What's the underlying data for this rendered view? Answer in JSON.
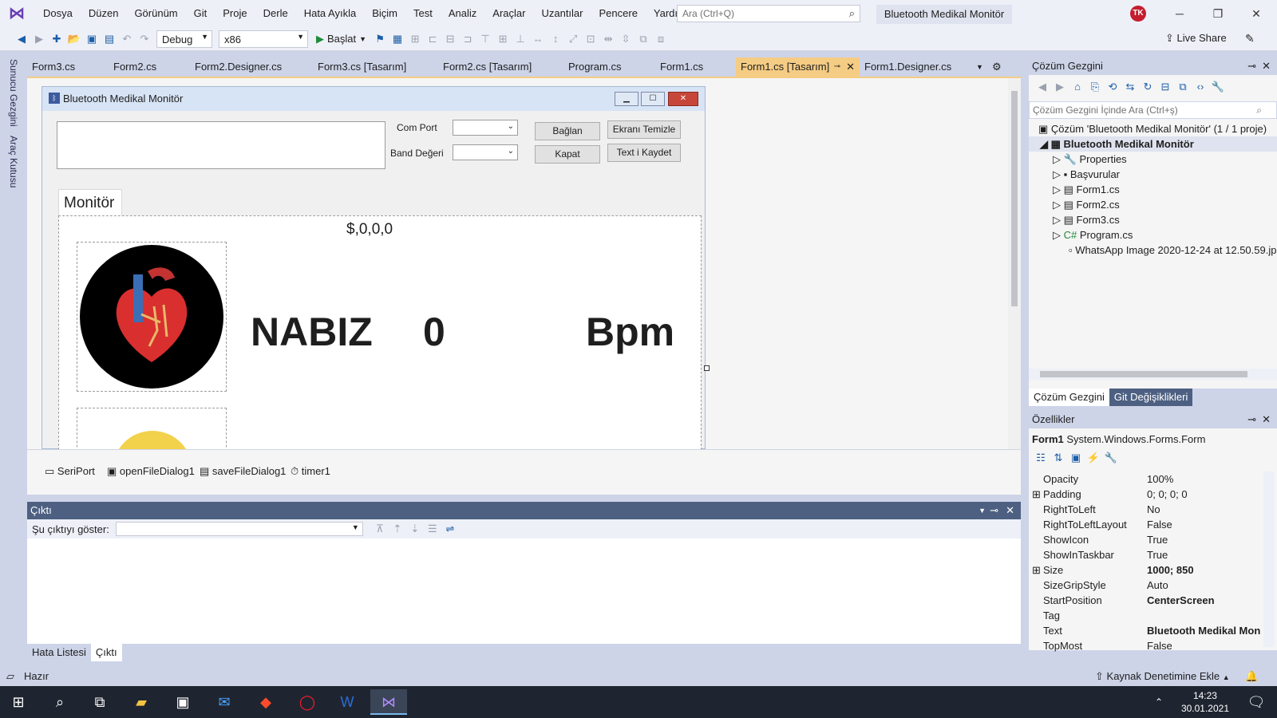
{
  "menubar": {
    "items": [
      "Dosya",
      "Düzen",
      "Görünüm",
      "Git",
      "Proje",
      "Derle",
      "Hata Ayıkla",
      "Biçim",
      "Test",
      "Analiz",
      "Araçlar",
      "Uzantılar",
      "Pencere",
      "Yardım"
    ],
    "search_placeholder": "Ara (Ctrl+Q)",
    "solution_title": "Bluetooth Medikal Monitör",
    "avatar": "TK"
  },
  "toolbar": {
    "config": "Debug",
    "platform": "x86",
    "start": "Başlat",
    "live_share": "Live Share"
  },
  "side_tabs": [
    "Sunucu Gezgini",
    "Araç Kutusu"
  ],
  "doc_tabs": [
    "Form3.cs",
    "Form2.cs",
    "Form2.Designer.cs",
    "Form3.cs [Tasarım]",
    "Form2.cs [Tasarım]",
    "Program.cs",
    "Form1.cs",
    "Form1.cs [Tasarım]",
    "Form1.Designer.cs"
  ],
  "active_tab_index": 7,
  "form": {
    "title": "Bluetooth Medikal Monitör",
    "com_port_label": "Com Port",
    "band_label": "Band Değeri",
    "connect": "Bağlan",
    "clear": "Ekranı Temizle",
    "close": "Kapat",
    "save": "Text i Kaydet",
    "tab": "Monitör",
    "serial_value": "$,0,0,0",
    "pulse_label": "NABIZ",
    "pulse_value": "0",
    "pulse_unit": "Bpm"
  },
  "tray": [
    "SeriPort",
    "openFileDialog1",
    "saveFileDialog1",
    "timer1"
  ],
  "output": {
    "title": "Çıktı",
    "show_label": "Şu çıktıyı göster:"
  },
  "bottom_tabs": [
    "Hata Listesi",
    "Çıktı"
  ],
  "solution_explorer": {
    "title": "Çözüm Gezgini",
    "search": "Çözüm Gezgini İçinde Ara (Ctrl+ş)",
    "solution": "Çözüm 'Bluetooth Medikal Monitör' (1 / 1 proje)",
    "project": "Bluetooth Medikal Monitör",
    "items": [
      "Properties",
      "Başvurular",
      "Form1.cs",
      "Form2.cs",
      "Form3.cs",
      "Program.cs",
      "WhatsApp Image 2020-12-24 at 12.50.59.jp"
    ],
    "tabs": [
      "Çözüm Gezgini",
      "Git Değişiklikleri"
    ]
  },
  "properties": {
    "title": "Özellikler",
    "object": "Form1",
    "type": "System.Windows.Forms.Form",
    "rows": [
      {
        "name": "Opacity",
        "value": "100%"
      },
      {
        "name": "Padding",
        "value": "0; 0; 0; 0"
      },
      {
        "name": "RightToLeft",
        "value": "No"
      },
      {
        "name": "RightToLeftLayout",
        "value": "False"
      },
      {
        "name": "ShowIcon",
        "value": "True"
      },
      {
        "name": "ShowInTaskbar",
        "value": "True"
      },
      {
        "name": "Size",
        "value": "1000; 850"
      },
      {
        "name": "SizeGripStyle",
        "value": "Auto"
      },
      {
        "name": "StartPosition",
        "value": "CenterScreen"
      },
      {
        "name": "Tag",
        "value": ""
      },
      {
        "name": "Text",
        "value": "Bluetooth Medikal Monitör"
      },
      {
        "name": "TopMost",
        "value": "False"
      }
    ]
  },
  "status": {
    "ready": "Hazır",
    "source_control": "Kaynak Denetimine Ekle"
  },
  "taskbar": {
    "time": "14:23",
    "date": "30.01.2021"
  }
}
